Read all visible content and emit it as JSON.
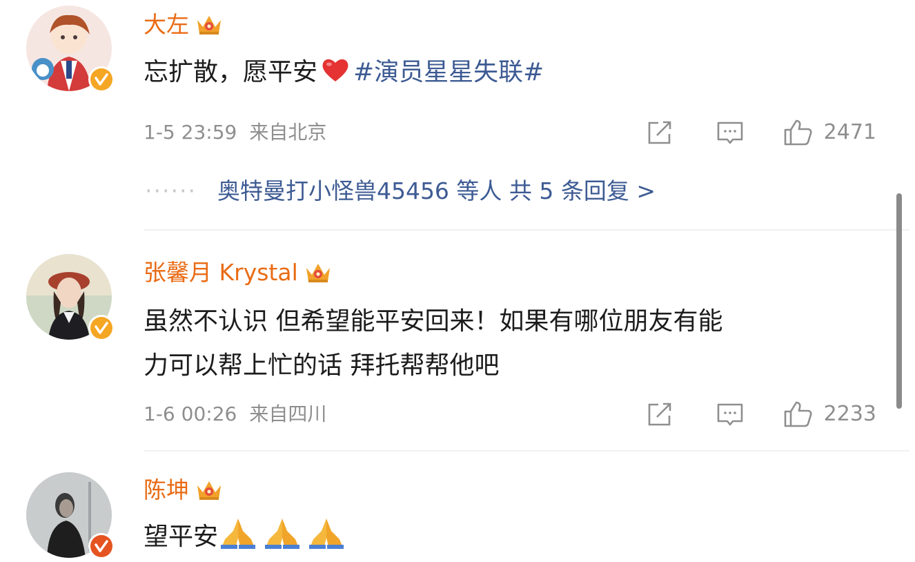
{
  "comments": [
    {
      "username": "大左",
      "text_plain": "忘扩散，愿平安",
      "hashtag": "#演员星星失联#",
      "time": "1-5 23:59",
      "source": "来自北京",
      "likes": "2471",
      "replies": {
        "dots": "······",
        "label": "奥特曼打小怪兽45456 等人  共 5 条回复 >"
      }
    },
    {
      "username": "张馨月 Krystal",
      "text_line1": "虽然不认识 但希望能平安回来！如果有哪位朋友有能",
      "text_line2": "力可以帮上忙的话 拜托帮帮他吧",
      "time": "1-6 00:26",
      "source": "来自四川",
      "likes": "2233"
    },
    {
      "username": "陈坤",
      "text_plain": "望平安"
    }
  ],
  "icons": {
    "vip": "crown-icon",
    "verified": "verified-badge-icon",
    "share": "share-icon",
    "comment": "comment-icon",
    "like": "thumbs-up-icon",
    "heart": "red-heart-emoji",
    "pray": "folded-hands-emoji"
  },
  "colors": {
    "username": "#e96b14",
    "hashtag": "#3d5b93",
    "meta": "#8e8e8e",
    "verified": "#f5a623"
  }
}
